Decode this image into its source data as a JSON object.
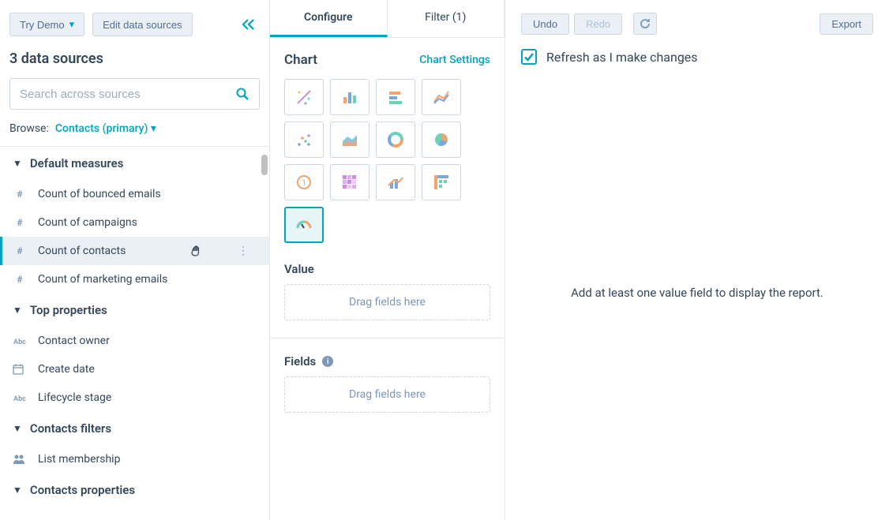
{
  "left": {
    "try_demo": "Try Demo",
    "edit_sources": "Edit data sources",
    "sources_title": "3 data sources",
    "search_placeholder": "Search across sources",
    "browse_label": "Browse:",
    "browse_value": "Contacts (primary)",
    "sections": [
      {
        "title": "Default measures",
        "items": [
          {
            "icon": "#",
            "label": "Count of bounced emails"
          },
          {
            "icon": "#",
            "label": "Count of campaigns"
          },
          {
            "icon": "#",
            "label": "Count of contacts",
            "hovered": true
          },
          {
            "icon": "#",
            "label": "Count of marketing emails"
          }
        ]
      },
      {
        "title": "Top properties",
        "items": [
          {
            "icon": "Abc",
            "label": "Contact owner"
          },
          {
            "icon": "cal",
            "label": "Create date"
          },
          {
            "icon": "Abc",
            "label": "Lifecycle stage"
          }
        ]
      },
      {
        "title": "Contacts filters",
        "items": [
          {
            "icon": "ppl",
            "label": "List membership"
          }
        ]
      },
      {
        "title": "Contacts properties",
        "items": []
      }
    ]
  },
  "mid": {
    "tabs": [
      {
        "label": "Configure",
        "active": true
      },
      {
        "label": "Filter (1)",
        "active": false
      }
    ],
    "chart_label": "Chart",
    "chart_settings": "Chart Settings",
    "chart_types": [
      "magic",
      "bar-vertical",
      "bar-horizontal",
      "line",
      "scatter",
      "area",
      "donut",
      "pie",
      "kpi",
      "heatmap",
      "combo",
      "pivot",
      "gauge"
    ],
    "chart_selected_index": 12,
    "value_label": "Value",
    "drag_hint": "Drag fields here",
    "fields_label": "Fields"
  },
  "right": {
    "undo": "Undo",
    "redo": "Redo",
    "export": "Export",
    "refresh_checkbox_label": "Refresh as I make changes",
    "refresh_checked": true,
    "placeholder": "Add at least one value field to display the report."
  }
}
